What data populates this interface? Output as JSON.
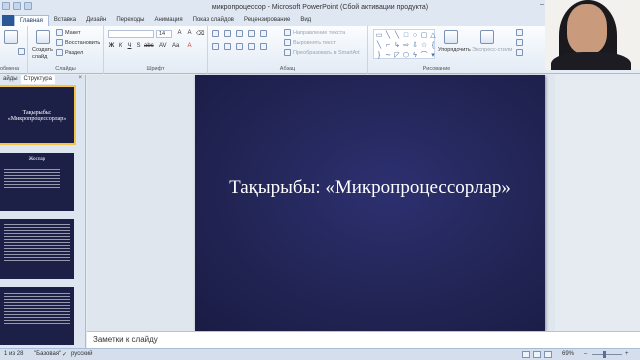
{
  "window": {
    "title": "микропроцессор  -  Microsoft PowerPoint (Сбой активации продукта)"
  },
  "tabs": [
    "Главная",
    "Вставка",
    "Дизайн",
    "Переходы",
    "Анимация",
    "Показ слайдов",
    "Рецензирование",
    "Вид"
  ],
  "ribbon": {
    "slides_group": {
      "label": "Слайды",
      "create_slide": "Создать слайд",
      "layout": "Макет",
      "reset": "Восстановить",
      "section": "Раздел"
    },
    "font_group": {
      "label": "Шрифт",
      "size": "14"
    },
    "paragraph_group": {
      "label": "Абзац",
      "text_direction": "Направление текста",
      "align_text": "Выровнять текст",
      "smartart": "Преобразовать в SmartArt"
    },
    "drawing_group": {
      "label": "Рисование",
      "arrange": "Упорядочить",
      "quick_styles": "Экспресс-стили"
    },
    "left_cut_label": "обмена"
  },
  "left_pane": {
    "tabs": [
      "айды",
      "Структура"
    ],
    "slides": [
      {
        "title": "Тақырыбы: «Микропроцессорлар»"
      },
      {
        "title": "Жоспар"
      }
    ]
  },
  "slide": {
    "title": "Тақырыбы: «Микропроцессорлар»"
  },
  "notes": {
    "placeholder": "Заметки к слайду"
  },
  "status": {
    "slide_counter": "1 из 28",
    "theme": "\"Базовая\"",
    "language": "русский",
    "zoom": "69%",
    "zoom_fraction": 0.4
  },
  "colors": {
    "slide_bg": "#222555",
    "accent_tab": "#2b5797",
    "selected_thumb": "#f5c54a"
  }
}
